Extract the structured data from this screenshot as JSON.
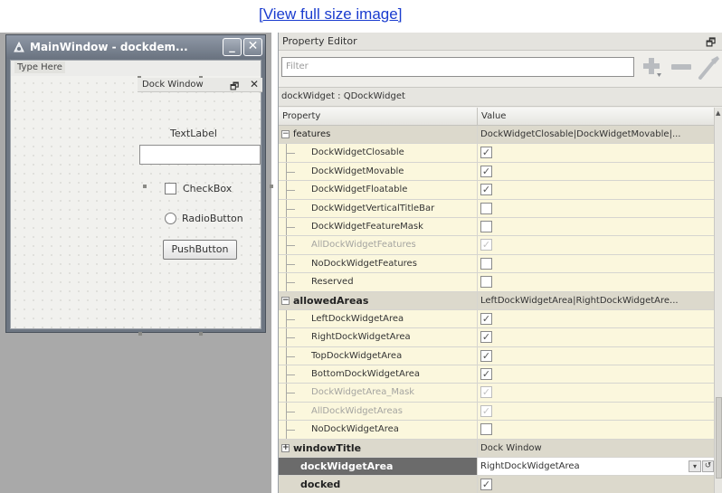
{
  "link_text": "[View full size image]",
  "main_window": {
    "title": "MainWindow - dockdem...",
    "minimize_glyph": "_",
    "close_glyph": "✕",
    "menu_placeholder": "Type Here",
    "dock": {
      "title": "Dock Window",
      "float_glyph": "🗗",
      "close_glyph": "✕",
      "text_label": "TextLabel",
      "checkbox_label": "CheckBox",
      "radio_label": "RadioButton",
      "push_button_label": "PushButton"
    }
  },
  "property_editor": {
    "title": "Property Editor",
    "float_glyph": "🗗",
    "filter_placeholder": "Filter",
    "object_name": "dockWidget : QDockWidget",
    "column_property": "Property",
    "column_value": "Value",
    "rows": [
      {
        "name": "features",
        "value": "DockWidgetClosable|DockWidgetMovable|...",
        "kind": "group",
        "expander": "−"
      },
      {
        "name": "DockWidgetClosable",
        "value": "✓",
        "kind": "check"
      },
      {
        "name": "DockWidgetMovable",
        "value": "✓",
        "kind": "check"
      },
      {
        "name": "DockWidgetFloatable",
        "value": "✓",
        "kind": "check"
      },
      {
        "name": "DockWidgetVerticalTitleBar",
        "value": "",
        "kind": "check"
      },
      {
        "name": "DockWidgetFeatureMask",
        "value": "",
        "kind": "check"
      },
      {
        "name": "AllDockWidgetFeatures",
        "value": "✓",
        "kind": "check-dim"
      },
      {
        "name": "NoDockWidgetFeatures",
        "value": "",
        "kind": "check"
      },
      {
        "name": "Reserved",
        "value": "",
        "kind": "check"
      },
      {
        "name": "allowedAreas",
        "value": "LeftDockWidgetArea|RightDockWidgetAre...",
        "kind": "group-bold",
        "expander": "−"
      },
      {
        "name": "LeftDockWidgetArea",
        "value": "✓",
        "kind": "check"
      },
      {
        "name": "RightDockWidgetArea",
        "value": "✓",
        "kind": "check"
      },
      {
        "name": "TopDockWidgetArea",
        "value": "✓",
        "kind": "check"
      },
      {
        "name": "BottomDockWidgetArea",
        "value": "✓",
        "kind": "check"
      },
      {
        "name": "DockWidgetArea_Mask",
        "value": "✓",
        "kind": "check-dim"
      },
      {
        "name": "AllDockWidgetAreas",
        "value": "✓",
        "kind": "check-dim"
      },
      {
        "name": "NoDockWidgetArea",
        "value": "",
        "kind": "check"
      },
      {
        "name": "windowTitle",
        "value": "Dock Window",
        "kind": "group-bold",
        "expander": "+"
      },
      {
        "name": "dockWidgetArea",
        "value": "RightDockWidgetArea",
        "kind": "selected"
      },
      {
        "name": "docked",
        "value": "✓",
        "kind": "bold-check"
      }
    ],
    "combo_glyph": "▾",
    "reset_glyph": "↺",
    "scroll_up_glyph": "▲"
  }
}
